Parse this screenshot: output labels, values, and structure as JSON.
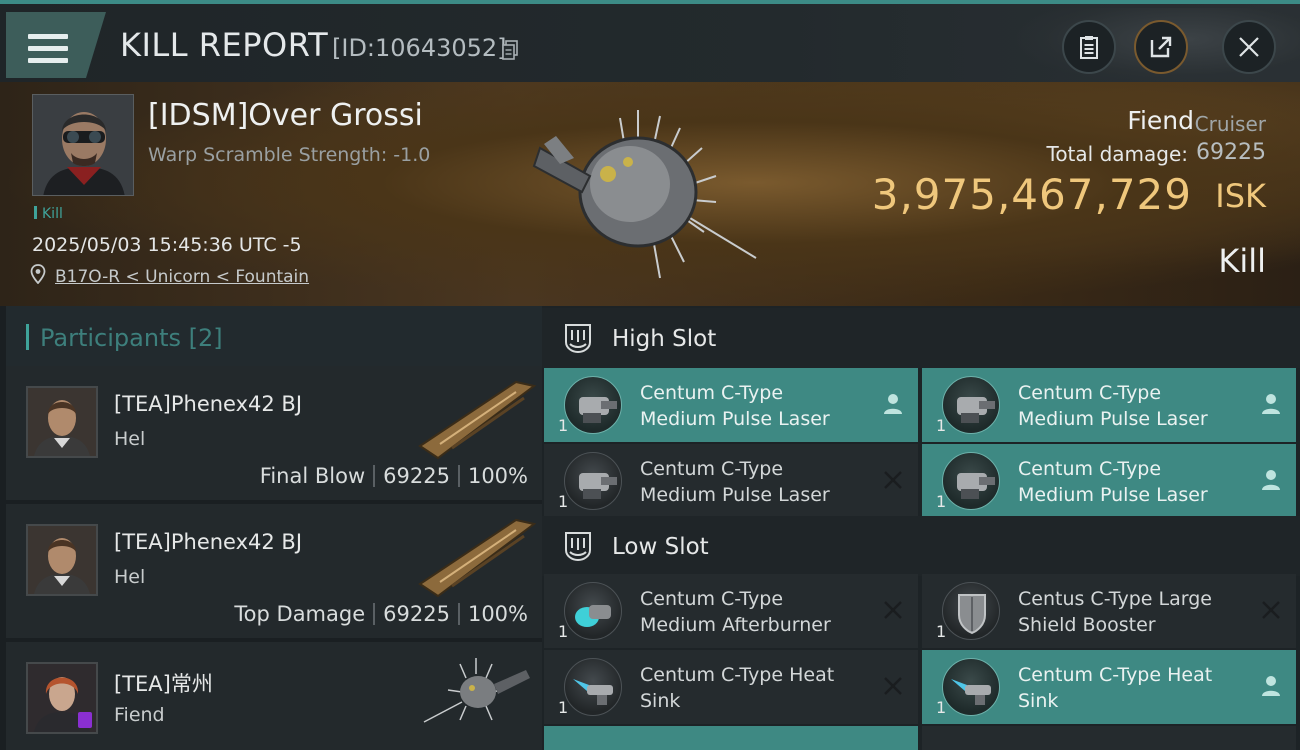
{
  "header": {
    "title": "KILL REPORT",
    "report_id": "[ID:10643052]"
  },
  "victim": {
    "name": "[IDSM]Over Grossi",
    "warp_scramble": "Warp Scramble Strength: -1.0",
    "tag": "Kill",
    "date": "2025/05/03 15:45:36 UTC -5",
    "location": "B17O-R < Unicorn < Fountain",
    "ship_name": "Fiend",
    "ship_class": "Cruiser",
    "total_damage_label": "Total damage:",
    "total_damage_value": "69225",
    "isk_value": "3,975,467,729",
    "isk_unit": "ISK",
    "result": "Kill"
  },
  "participants": {
    "title": "Participants [2]",
    "items": [
      {
        "name": "[TEA]Phenex42 BJ",
        "ship": "Hel",
        "role": "Final Blow",
        "damage": "69225",
        "percent": "100%"
      },
      {
        "name": "[TEA]Phenex42 BJ",
        "ship": "Hel",
        "role": "Top Damage",
        "damage": "69225",
        "percent": "100%"
      },
      {
        "name": "[TEA]常州",
        "ship": "Fiend"
      }
    ]
  },
  "high_slot": {
    "title": "High Slot",
    "modules": [
      {
        "line1": "Centum C-Type",
        "line2": "Medium Pulse Laser",
        "qty": "1",
        "status": "dropped"
      },
      {
        "line1": "Centum C-Type",
        "line2": "Medium Pulse Laser",
        "qty": "1",
        "status": "dropped"
      },
      {
        "line1": "Centum C-Type",
        "line2": "Medium Pulse Laser",
        "qty": "1",
        "status": "destroyed"
      },
      {
        "line1": "Centum C-Type",
        "line2": "Medium Pulse Laser",
        "qty": "1",
        "status": "dropped"
      }
    ]
  },
  "low_slot": {
    "title": "Low Slot",
    "modules": [
      {
        "line1": "Centum C-Type",
        "line2": "Medium Afterburner",
        "qty": "1",
        "status": "destroyed"
      },
      {
        "line1": "Centus C-Type Large",
        "line2": "Shield Booster",
        "qty": "1",
        "status": "destroyed"
      },
      {
        "line1": "Centum C-Type Heat",
        "line2": "Sink",
        "qty": "1",
        "status": "destroyed"
      },
      {
        "line1": "Centum C-Type Heat",
        "line2": "Sink",
        "qty": "1",
        "status": "dropped"
      }
    ]
  },
  "colors": {
    "accent": "#3fa39a",
    "active_module": "#3e8983",
    "isk": "#efc77c"
  }
}
